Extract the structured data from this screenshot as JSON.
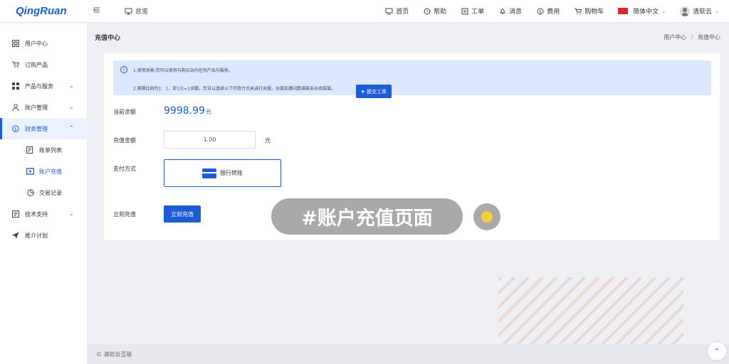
{
  "brand": {
    "logo": "QingRuan"
  },
  "header": {
    "overview_label": "总览",
    "nav": [
      {
        "label": "首页",
        "icon": "monitor-icon"
      },
      {
        "label": "帮助",
        "icon": "help-icon"
      },
      {
        "label": "工单",
        "icon": "ticket-icon"
      },
      {
        "label": "消息",
        "icon": "bell-icon"
      },
      {
        "label": "费用",
        "icon": "currency-icon"
      },
      {
        "label": "购物车",
        "icon": "cart-icon"
      }
    ],
    "language": "简体中文",
    "user": "清软云"
  },
  "sidebar": {
    "items": [
      {
        "label": "用户中心"
      },
      {
        "label": "订购产品"
      },
      {
        "label": "产品与服务"
      },
      {
        "label": "账户管理"
      },
      {
        "label": "财务管理"
      },
      {
        "label": "账单列表"
      },
      {
        "label": "账户充值"
      },
      {
        "label": "交易记录"
      },
      {
        "label": "技术支持"
      },
      {
        "label": "推介计划"
      }
    ]
  },
  "page": {
    "title": "充值中心",
    "breadcrumb": [
      "用户中心",
      "充值中心"
    ]
  },
  "notice": {
    "line1": "1.使用场景:您可以使用与购买站内任何产品与服务。",
    "line2": "2.换算比例为1：1，即1元=1余额，您可以选择以下付款方式来进行充值，充值如遇问题请联系在线客服。",
    "ticket_button": "提交工单"
  },
  "form": {
    "balance_label": "当前余额",
    "balance_value": "9998.99",
    "balance_unit": "元",
    "amount_label": "充值金额",
    "amount_value": "1.00",
    "amount_unit": "元",
    "method_label": "支付方式",
    "method_option": "银行转账",
    "submit_label": "立刻充值",
    "submit_button": "立刻充值"
  },
  "overlay": {
    "caption": "#账户充值页面"
  },
  "footer": {
    "copyright": "© 清软云互联"
  },
  "colors": {
    "accent": "#1e5bd6",
    "notice_bg": "#dbe8ff"
  }
}
